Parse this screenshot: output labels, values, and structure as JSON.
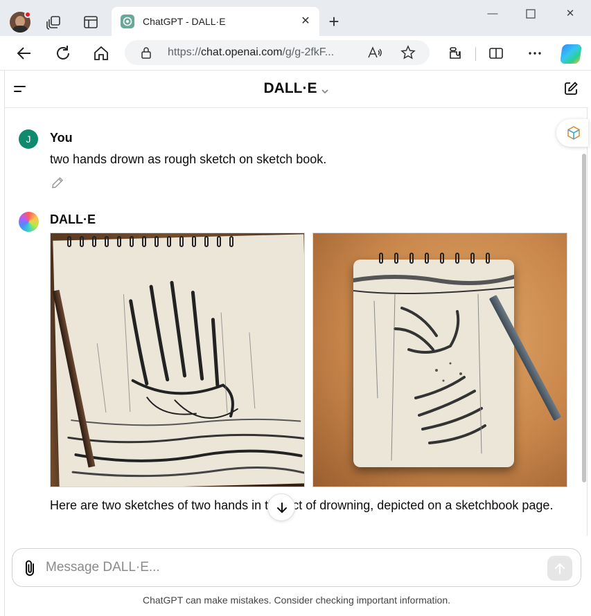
{
  "browser": {
    "tab_title": "ChatGPT - DALL·E",
    "url_prefix": "https://",
    "url_host": "chat.openai.com",
    "url_path": "/g/g-2fkF...",
    "read_aloud_label": "A⁾"
  },
  "app": {
    "title": "DALL·E",
    "messages": [
      {
        "author": "You",
        "avatar_initial": "J",
        "text": "two hands drown as rough sketch on sketch book."
      },
      {
        "author": "DALL·E",
        "text": "Here are two sketches of two hands in the act of drowning, depicted on a sketchbook page."
      }
    ],
    "composer": {
      "placeholder": "Message DALL·E..."
    },
    "disclaimer": "ChatGPT can make mistakes. Consider checking important information."
  },
  "colors": {
    "user_avatar": "#0f8a6e",
    "chrome_bg": "#e8ecf0"
  }
}
